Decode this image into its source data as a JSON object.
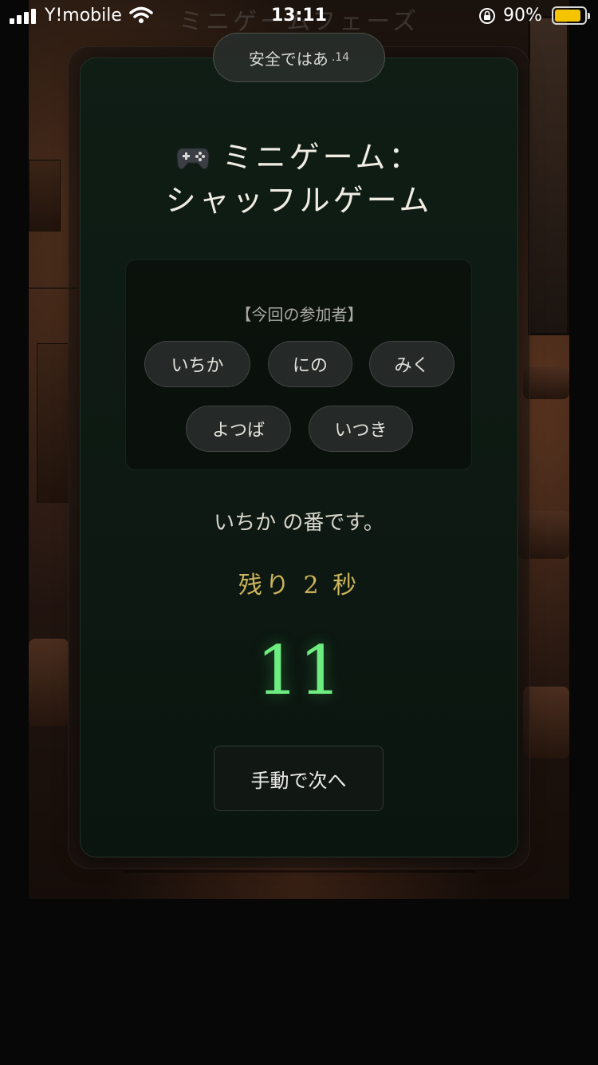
{
  "status_bar": {
    "carrier": "Y!mobile",
    "time": "13:11",
    "battery_percent": "90%",
    "battery_level": 0.9,
    "page_title_ghost": "ミニゲームフェーズ"
  },
  "url_pill": {
    "text": "安全ではあ",
    "suffix": ".14"
  },
  "game": {
    "title_line1": "ミニゲーム：",
    "title_line2": "シャッフルゲーム",
    "participants_label": "【今回の参加者】",
    "participants": [
      "いちか",
      "にの",
      "みく",
      "よつば",
      "いつき"
    ],
    "turn_text": "いちか の番です。",
    "remaining_text": "残り 2 秒",
    "big_number": "11",
    "next_button_label": "手動で次へ"
  },
  "colors": {
    "accent_green": "#6dec80",
    "accent_gold": "#cdb55b",
    "card_bg": "#0f1d15",
    "battery_fill": "#f5c400"
  }
}
